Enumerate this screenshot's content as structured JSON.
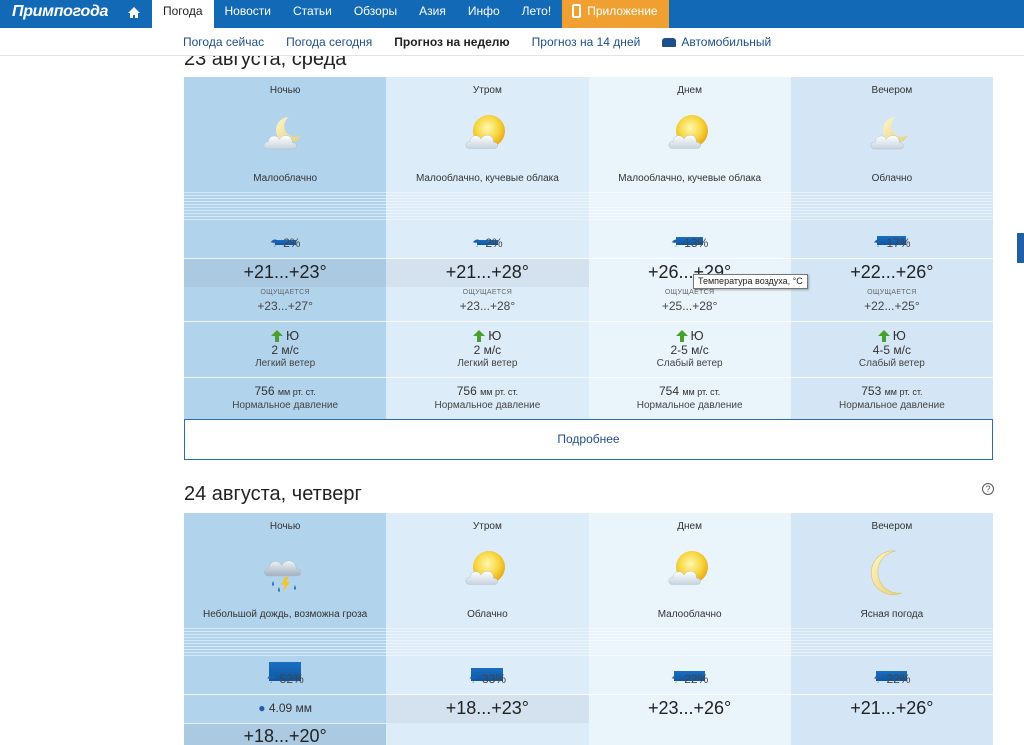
{
  "brand": {
    "logo": "Примпогода"
  },
  "nav": {
    "items": [
      {
        "label": "Погода",
        "active": true
      },
      {
        "label": "Новости"
      },
      {
        "label": "Статьи"
      },
      {
        "label": "Обзоры"
      },
      {
        "label": "Азия"
      },
      {
        "label": "Инфо"
      },
      {
        "label": "Лето!"
      }
    ],
    "app_label": "Приложение"
  },
  "subnav": {
    "items": [
      "Погода сейчас",
      "Погода сегодня",
      "Прогноз на неделю",
      "Прогноз на 14 дней"
    ],
    "active": "Прогноз на неделю",
    "auto_label": "Автомобильный"
  },
  "colors": {
    "brand": "#1269b6",
    "app_button": "#f0a030",
    "wind_arrow": "#4aa02c",
    "precip_bar": "#1a6fc2"
  },
  "days": [
    {
      "title": "23 августа, среда",
      "more_label": "Подробнее",
      "periods": [
        {
          "period": "Ночью",
          "icon": "moon-cloud-icon",
          "condition": "Малооблачно",
          "precip_level": 0.02,
          "precip": "2%",
          "temp": "+21...+23°",
          "feels_label": "ощущается",
          "feels": "+23...+27°",
          "wind_dir": "Ю",
          "wind_speed": "2 м/с",
          "wind_desc": "Легкий ветер",
          "pressure": "756",
          "pressure_unit": "мм рт. ст.",
          "pressure_desc": "Нормальное давление"
        },
        {
          "period": "Утром",
          "icon": "sun-cloud-icon",
          "condition": "Малооблачно, кучевые облака",
          "precip_level": 0.02,
          "precip": "2%",
          "temp": "+21...+28°",
          "feels_label": "ощущается",
          "feels": "+23...+28°",
          "wind_dir": "Ю",
          "wind_speed": "2 м/с",
          "wind_desc": "Легкий ветер",
          "pressure": "756",
          "pressure_unit": "мм рт. ст.",
          "pressure_desc": "Нормальное давление"
        },
        {
          "period": "Днем",
          "icon": "sun-cloud-icon",
          "condition": "Малооблачно, кучевые облака",
          "precip_level": 0.13,
          "precip": "13%",
          "temp": "+26...+29°",
          "feels_label": "ощущается",
          "feels": "+25...+28°",
          "wind_dir": "Ю",
          "wind_speed": "2-5 м/с",
          "wind_desc": "Слабый ветер",
          "pressure": "754",
          "pressure_unit": "мм рт. ст.",
          "pressure_desc": "Нормальное давление"
        },
        {
          "period": "Вечером",
          "icon": "moon-cloud-icon",
          "condition": "Облачно",
          "precip_level": 0.17,
          "precip": "17%",
          "temp": "+22...+26°",
          "feels_label": "ощущается",
          "feels": "+22...+25°",
          "wind_dir": "Ю",
          "wind_speed": "4-5 м/с",
          "wind_desc": "Слабый ветер",
          "pressure": "753",
          "pressure_unit": "мм рт. ст.",
          "pressure_desc": "Нормальное давление"
        }
      ]
    },
    {
      "title": "24 августа, четверг",
      "periods": [
        {
          "period": "Ночью",
          "icon": "thunder-rain-icon",
          "condition": "Небольшой дождь, возможна гроза",
          "precip_level": 0.52,
          "precip": "52%",
          "rain_amount": "4.09 мм",
          "temp": "+18...+20°"
        },
        {
          "period": "Утром",
          "icon": "sun-cloud-icon",
          "condition": "Облачно",
          "precip_level": 0.33,
          "precip": "33%",
          "temp": "+18...+23°"
        },
        {
          "period": "Днем",
          "icon": "sun-cloud-icon",
          "condition": "Малооблачно",
          "precip_level": 0.22,
          "precip": "22%",
          "temp": "+23...+26°"
        },
        {
          "period": "Вечером",
          "icon": "moon-icon",
          "condition": "Ясная погода",
          "precip_level": 0.22,
          "precip": "22%",
          "temp": "+21...+26°"
        }
      ]
    }
  ],
  "tooltip": "Температура воздуха, °С"
}
